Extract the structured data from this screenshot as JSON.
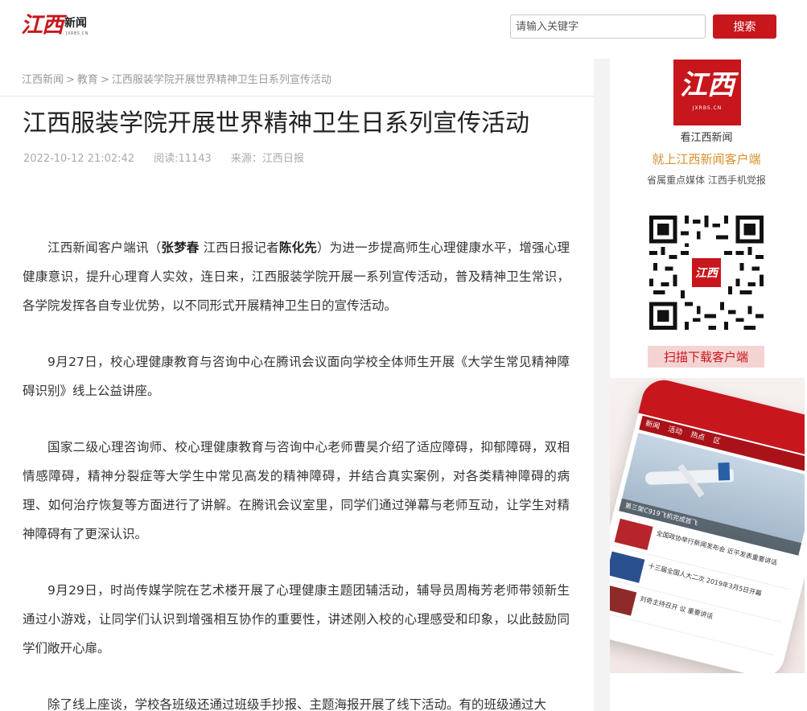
{
  "header": {
    "logo_mark": "江西",
    "logo_text": "新闻",
    "logo_sub": "JXRBS.CN",
    "search_placeholder": "请输入关键字",
    "search_button": "搜索"
  },
  "breadcrumb": {
    "items": [
      "江西新闻",
      "教育",
      "江西服装学院开展世界精神卫生日系列宣传活动"
    ]
  },
  "article": {
    "title": "江西服装学院开展世界精神卫生日系列宣传活动",
    "date": "2022-10-12 21:02:42",
    "reads": "阅读:11143",
    "source": "来源：江西日报",
    "paragraphs": [
      {
        "pre": "江西新闻客户端讯（",
        "b1": "张梦春",
        "mid": " 江西日报记者",
        "b2": "陈化先",
        "post": "）为进一步提高师生心理健康水平，增强心理健康意识，提升心理育人实效，连日来，江西服装学院开展一系列宣传活动，普及精神卫生常识，各学院发挥各自专业优势，以不同形式开展精神卫生日的宣传活动。"
      },
      {
        "text": "9月27日，校心理健康教育与咨询中心在腾讯会议面向学校全体师生开展《大学生常见精神障碍识别》线上公益讲座。"
      },
      {
        "text": "国家二级心理咨询师、校心理健康教育与咨询中心老师曹昊介绍了适应障碍，抑郁障碍，双相情感障碍，精神分裂症等大学生中常见高发的精神障碍，并结合真实案例，对各类精神障碍的病理、如何治疗恢复等方面进行了讲解。在腾讯会议室里，同学们通过弹幕与老师互动，让学生对精神障碍有了更深认识。"
      },
      {
        "text": "9月29日，时尚传媒学院在艺术楼开展了心理健康主题团辅活动，辅导员周梅芳老师带领新生通过小游戏，让同学们认识到增强相互协作的重要性，讲述刚入校的心理感受和印象，以此鼓励同学们敞开心扉。"
      },
      {
        "text": "除了线上座谈，学校各班级还通过班级手抄报、主题海报开展了线下活动。有的班级通过大"
      }
    ]
  },
  "sidebar": {
    "app_icon_mark": "江西",
    "app_icon_sub": "JXRBS.CN",
    "caption": "看江西新闻",
    "promo": "就上江西新闻客户端",
    "tagline": "省属重点媒体 江西手机党报",
    "qr_center": "江西",
    "scan_button": "扫描下载客户端",
    "phone": {
      "tabs": "新闻 活动 热点 区",
      "hero_caption": "第三架C919飞机完成首飞",
      "news": [
        "全国政协举行新闻发布会 近平发表重要讲话",
        "十三届全国人大二次 2019年3月5日开幕",
        "刘奇主持召开 议 重要讲话"
      ]
    },
    "colors": {
      "brand_red": "#c8161d",
      "promo_gold": "#d9902e"
    }
  }
}
